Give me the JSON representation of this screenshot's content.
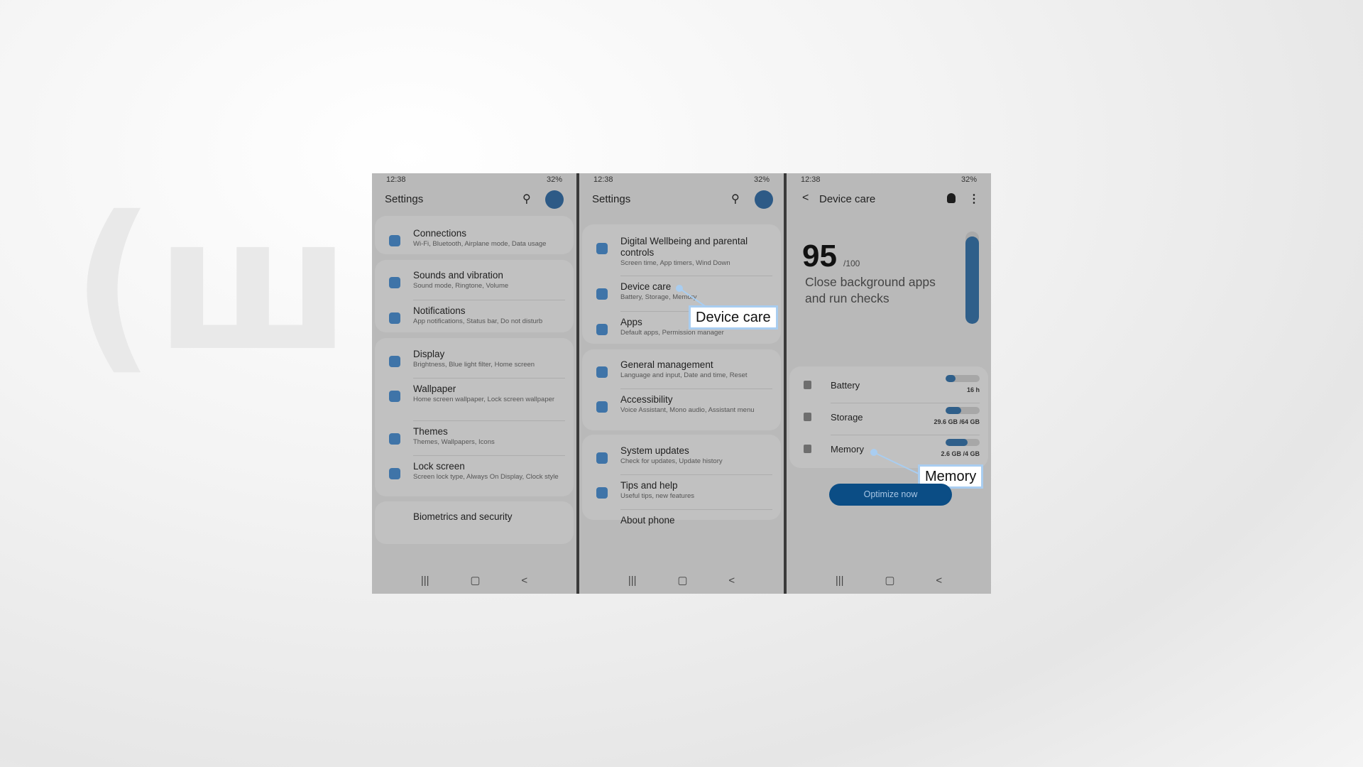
{
  "status": {
    "time": "12:38",
    "battery": "32%"
  },
  "panel1": {
    "title": "Settings",
    "groups": [
      [
        {
          "icon": "wifi-icon",
          "title": "Connections",
          "sub": "Wi-Fi, Bluetooth, Airplane mode, Data usage"
        }
      ],
      [
        {
          "icon": "volume-icon",
          "title": "Sounds and vibration",
          "sub": "Sound mode, Ringtone, Volume"
        },
        {
          "icon": "notification-icon",
          "title": "Notifications",
          "sub": "App notifications, Status bar, Do not disturb"
        }
      ],
      [
        {
          "icon": "brightness-icon",
          "title": "Display",
          "sub": "Brightness, Blue light filter, Home screen"
        },
        {
          "icon": "wallpaper-icon",
          "title": "Wallpaper",
          "sub": "Home screen wallpaper, Lock screen wallpaper"
        },
        {
          "icon": "themes-icon",
          "title": "Themes",
          "sub": "Themes, Wallpapers, Icons"
        },
        {
          "icon": "lock-icon",
          "title": "Lock screen",
          "sub": "Screen lock type, Always On Display, Clock style"
        }
      ],
      [
        {
          "icon": "",
          "title": "Biometrics and security",
          "sub": ""
        }
      ]
    ]
  },
  "panel2": {
    "title": "Settings",
    "groups": [
      [
        {
          "icon": "wellbeing-icon",
          "title": "Digital Wellbeing and parental controls",
          "sub": "Screen time, App timers, Wind Down"
        },
        {
          "icon": "device-care-icon",
          "title": "Device care",
          "sub": "Battery, Storage, Memory"
        },
        {
          "icon": "apps-icon",
          "title": "Apps",
          "sub": "Default apps, Permission manager"
        }
      ],
      [
        {
          "icon": "sliders-icon",
          "title": "General management",
          "sub": "Language and input, Date and time, Reset"
        },
        {
          "icon": "accessibility-icon",
          "title": "Accessibility",
          "sub": "Voice Assistant, Mono audio, Assistant menu"
        }
      ],
      [
        {
          "icon": "system-update-icon",
          "title": "System updates",
          "sub": "Check for updates, Update history"
        },
        {
          "icon": "lightbulb-icon",
          "title": "Tips and help",
          "sub": "Useful tips, new features"
        },
        {
          "icon": "",
          "title": "About phone",
          "sub": ""
        }
      ]
    ],
    "callout": "Device care"
  },
  "panel3": {
    "title": "Device care",
    "score": "95",
    "score_max": "/100",
    "message": "Close background apps and run checks",
    "score_fill": 0.95,
    "rows": [
      {
        "icon": "battery-icon",
        "label": "Battery",
        "value": "16 h",
        "fill": 0.3
      },
      {
        "icon": "storage-icon",
        "label": "Storage",
        "value": "29.6 GB /64 GB",
        "fill": 0.46
      },
      {
        "icon": "memory-icon",
        "label": "Memory",
        "value": "2.6 GB /4 GB",
        "fill": 0.65
      }
    ],
    "button": "Optimize now",
    "callout": "Memory"
  },
  "colors": {
    "accent": "#3f74a8",
    "button": "#0b4d85",
    "callout_border": "#a9cdf0"
  }
}
